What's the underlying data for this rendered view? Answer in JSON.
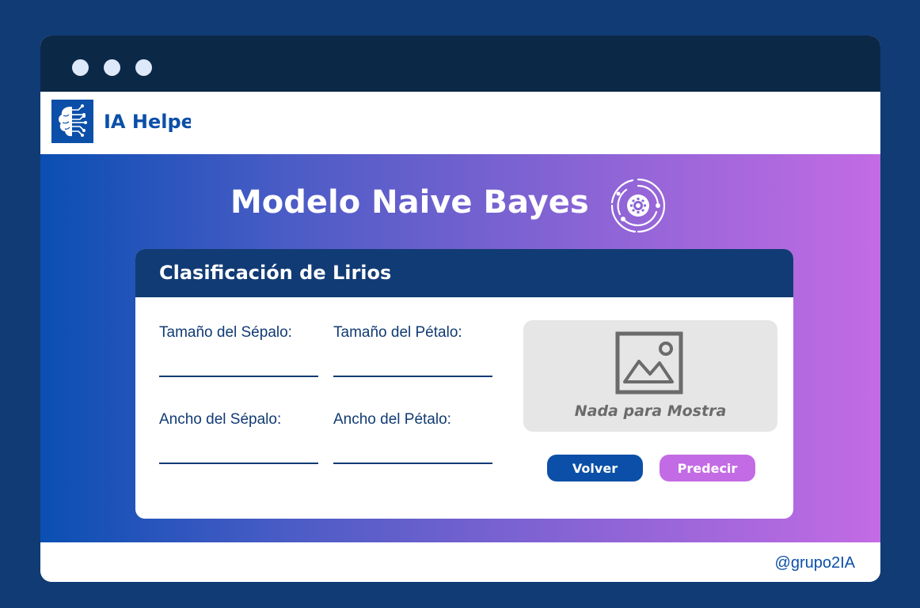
{
  "window": {
    "controls": [
      "window-dot",
      "window-dot",
      "window-dot"
    ]
  },
  "appbar": {
    "logo_icon": "brain-circuit-icon",
    "name": "IA Helper"
  },
  "hero": {
    "title": "Modelo Naive Bayes",
    "icon": "gear-orbit-icon"
  },
  "card": {
    "title": "Clasificación de Lirios",
    "fields": {
      "sepal_size": {
        "label": "Tamaño del Sépalo:",
        "value": ""
      },
      "petal_size": {
        "label": "Tamaño del Pétalo:",
        "value": ""
      },
      "sepal_width": {
        "label": "Ancho del Sépalo:",
        "value": ""
      },
      "petal_width": {
        "label": "Ancho del Pétalo:",
        "value": ""
      }
    },
    "preview": {
      "icon": "image-placeholder-icon",
      "text": "Nada para Mostra"
    },
    "buttons": {
      "back": "Volver",
      "predict": "Predecir"
    }
  },
  "footer": {
    "credit": "@grupo2IA"
  },
  "colors": {
    "background": "#113b74",
    "titlebar": "#0b2847",
    "brand_blue": "#0b4fa8",
    "accent_purple": "#c36be4",
    "placeholder_bg": "#e6e6e6"
  }
}
